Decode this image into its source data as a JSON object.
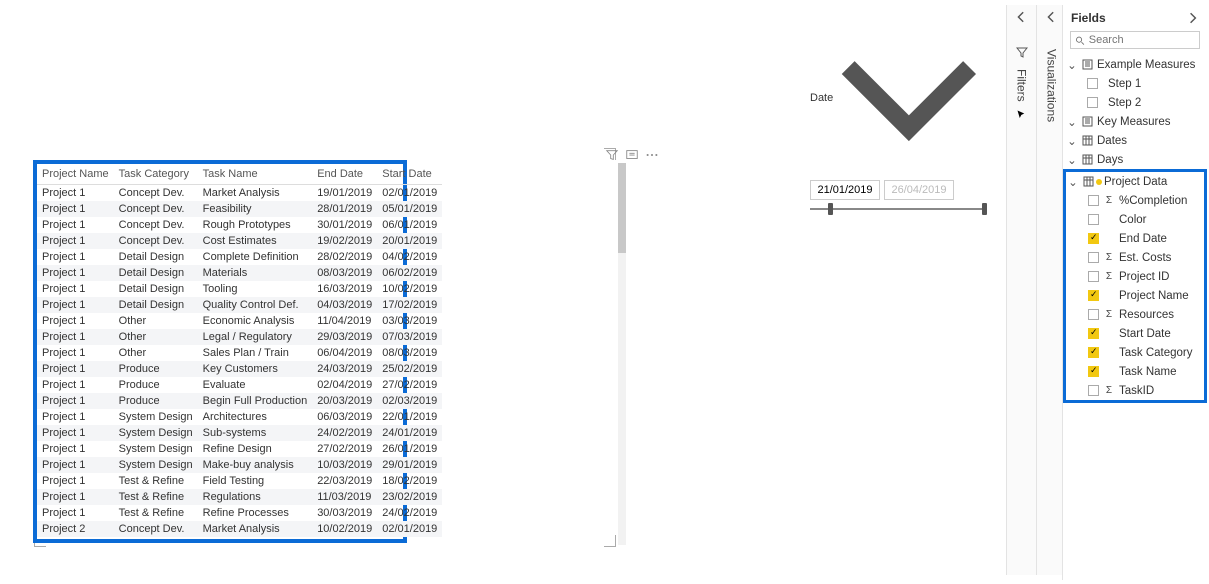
{
  "dateFilter": {
    "label": "Date",
    "start": "21/01/2019",
    "end": "26/04/2019"
  },
  "collapsed": {
    "filters": "Filters",
    "visualizations": "Visualizations"
  },
  "table": {
    "columns": [
      "Project Name",
      "Task Category",
      "Task Name",
      "End Date",
      "Start Date"
    ],
    "rows": [
      [
        "Project 1",
        "Concept Dev.",
        "Market Analysis",
        "19/01/2019",
        "02/01/2019"
      ],
      [
        "Project 1",
        "Concept Dev.",
        "Feasibility",
        "28/01/2019",
        "05/01/2019"
      ],
      [
        "Project 1",
        "Concept Dev.",
        "Rough Prototypes",
        "30/01/2019",
        "06/01/2019"
      ],
      [
        "Project 1",
        "Concept Dev.",
        "Cost Estimates",
        "19/02/2019",
        "20/01/2019"
      ],
      [
        "Project 1",
        "Detail Design",
        "Complete Definition",
        "28/02/2019",
        "04/02/2019"
      ],
      [
        "Project 1",
        "Detail Design",
        "Materials",
        "08/03/2019",
        "06/02/2019"
      ],
      [
        "Project 1",
        "Detail Design",
        "Tooling",
        "16/03/2019",
        "10/02/2019"
      ],
      [
        "Project 1",
        "Detail Design",
        "Quality Control Def.",
        "04/03/2019",
        "17/02/2019"
      ],
      [
        "Project 1",
        "Other",
        "Economic Analysis",
        "11/04/2019",
        "03/03/2019"
      ],
      [
        "Project 1",
        "Other",
        "Legal / Regulatory",
        "29/03/2019",
        "07/03/2019"
      ],
      [
        "Project 1",
        "Other",
        "Sales Plan / Train",
        "06/04/2019",
        "08/03/2019"
      ],
      [
        "Project 1",
        "Produce",
        "Key Customers",
        "24/03/2019",
        "25/02/2019"
      ],
      [
        "Project 1",
        "Produce",
        "Evaluate",
        "02/04/2019",
        "27/02/2019"
      ],
      [
        "Project 1",
        "Produce",
        "Begin Full Production",
        "20/03/2019",
        "02/03/2019"
      ],
      [
        "Project 1",
        "System Design",
        "Architectures",
        "06/03/2019",
        "22/01/2019"
      ],
      [
        "Project 1",
        "System Design",
        "Sub-systems",
        "24/02/2019",
        "24/01/2019"
      ],
      [
        "Project 1",
        "System Design",
        "Refine Design",
        "27/02/2019",
        "26/01/2019"
      ],
      [
        "Project 1",
        "System Design",
        "Make-buy analysis",
        "10/03/2019",
        "29/01/2019"
      ],
      [
        "Project 1",
        "Test & Refine",
        "Field Testing",
        "22/03/2019",
        "18/02/2019"
      ],
      [
        "Project 1",
        "Test & Refine",
        "Regulations",
        "11/03/2019",
        "23/02/2019"
      ],
      [
        "Project 1",
        "Test & Refine",
        "Refine Processes",
        "30/03/2019",
        "24/02/2019"
      ],
      [
        "Project 2",
        "Concept Dev.",
        "Market Analysis",
        "10/02/2019",
        "02/01/2019"
      ]
    ]
  },
  "fields": {
    "title": "Fields",
    "searchPlaceholder": "Search",
    "tables": {
      "exampleMeasures": {
        "label": "Example Measures",
        "items": [
          "Step 1",
          "Step 2"
        ]
      },
      "keyMeasures": "Key Measures",
      "dates": "Dates",
      "days": "Days",
      "projectData": {
        "label": "Project Data",
        "fields": [
          {
            "name": "%Completion",
            "checked": false,
            "sigma": true
          },
          {
            "name": "Color",
            "checked": false,
            "sigma": false
          },
          {
            "name": "End Date",
            "checked": true,
            "sigma": false
          },
          {
            "name": "Est. Costs",
            "checked": false,
            "sigma": true
          },
          {
            "name": "Project ID",
            "checked": false,
            "sigma": true
          },
          {
            "name": "Project Name",
            "checked": true,
            "sigma": false
          },
          {
            "name": "Resources",
            "checked": false,
            "sigma": true
          },
          {
            "name": "Start Date",
            "checked": true,
            "sigma": false
          },
          {
            "name": "Task Category",
            "checked": true,
            "sigma": false
          },
          {
            "name": "Task Name",
            "checked": true,
            "sigma": false
          },
          {
            "name": "TaskID",
            "checked": false,
            "sigma": true
          }
        ]
      }
    }
  }
}
